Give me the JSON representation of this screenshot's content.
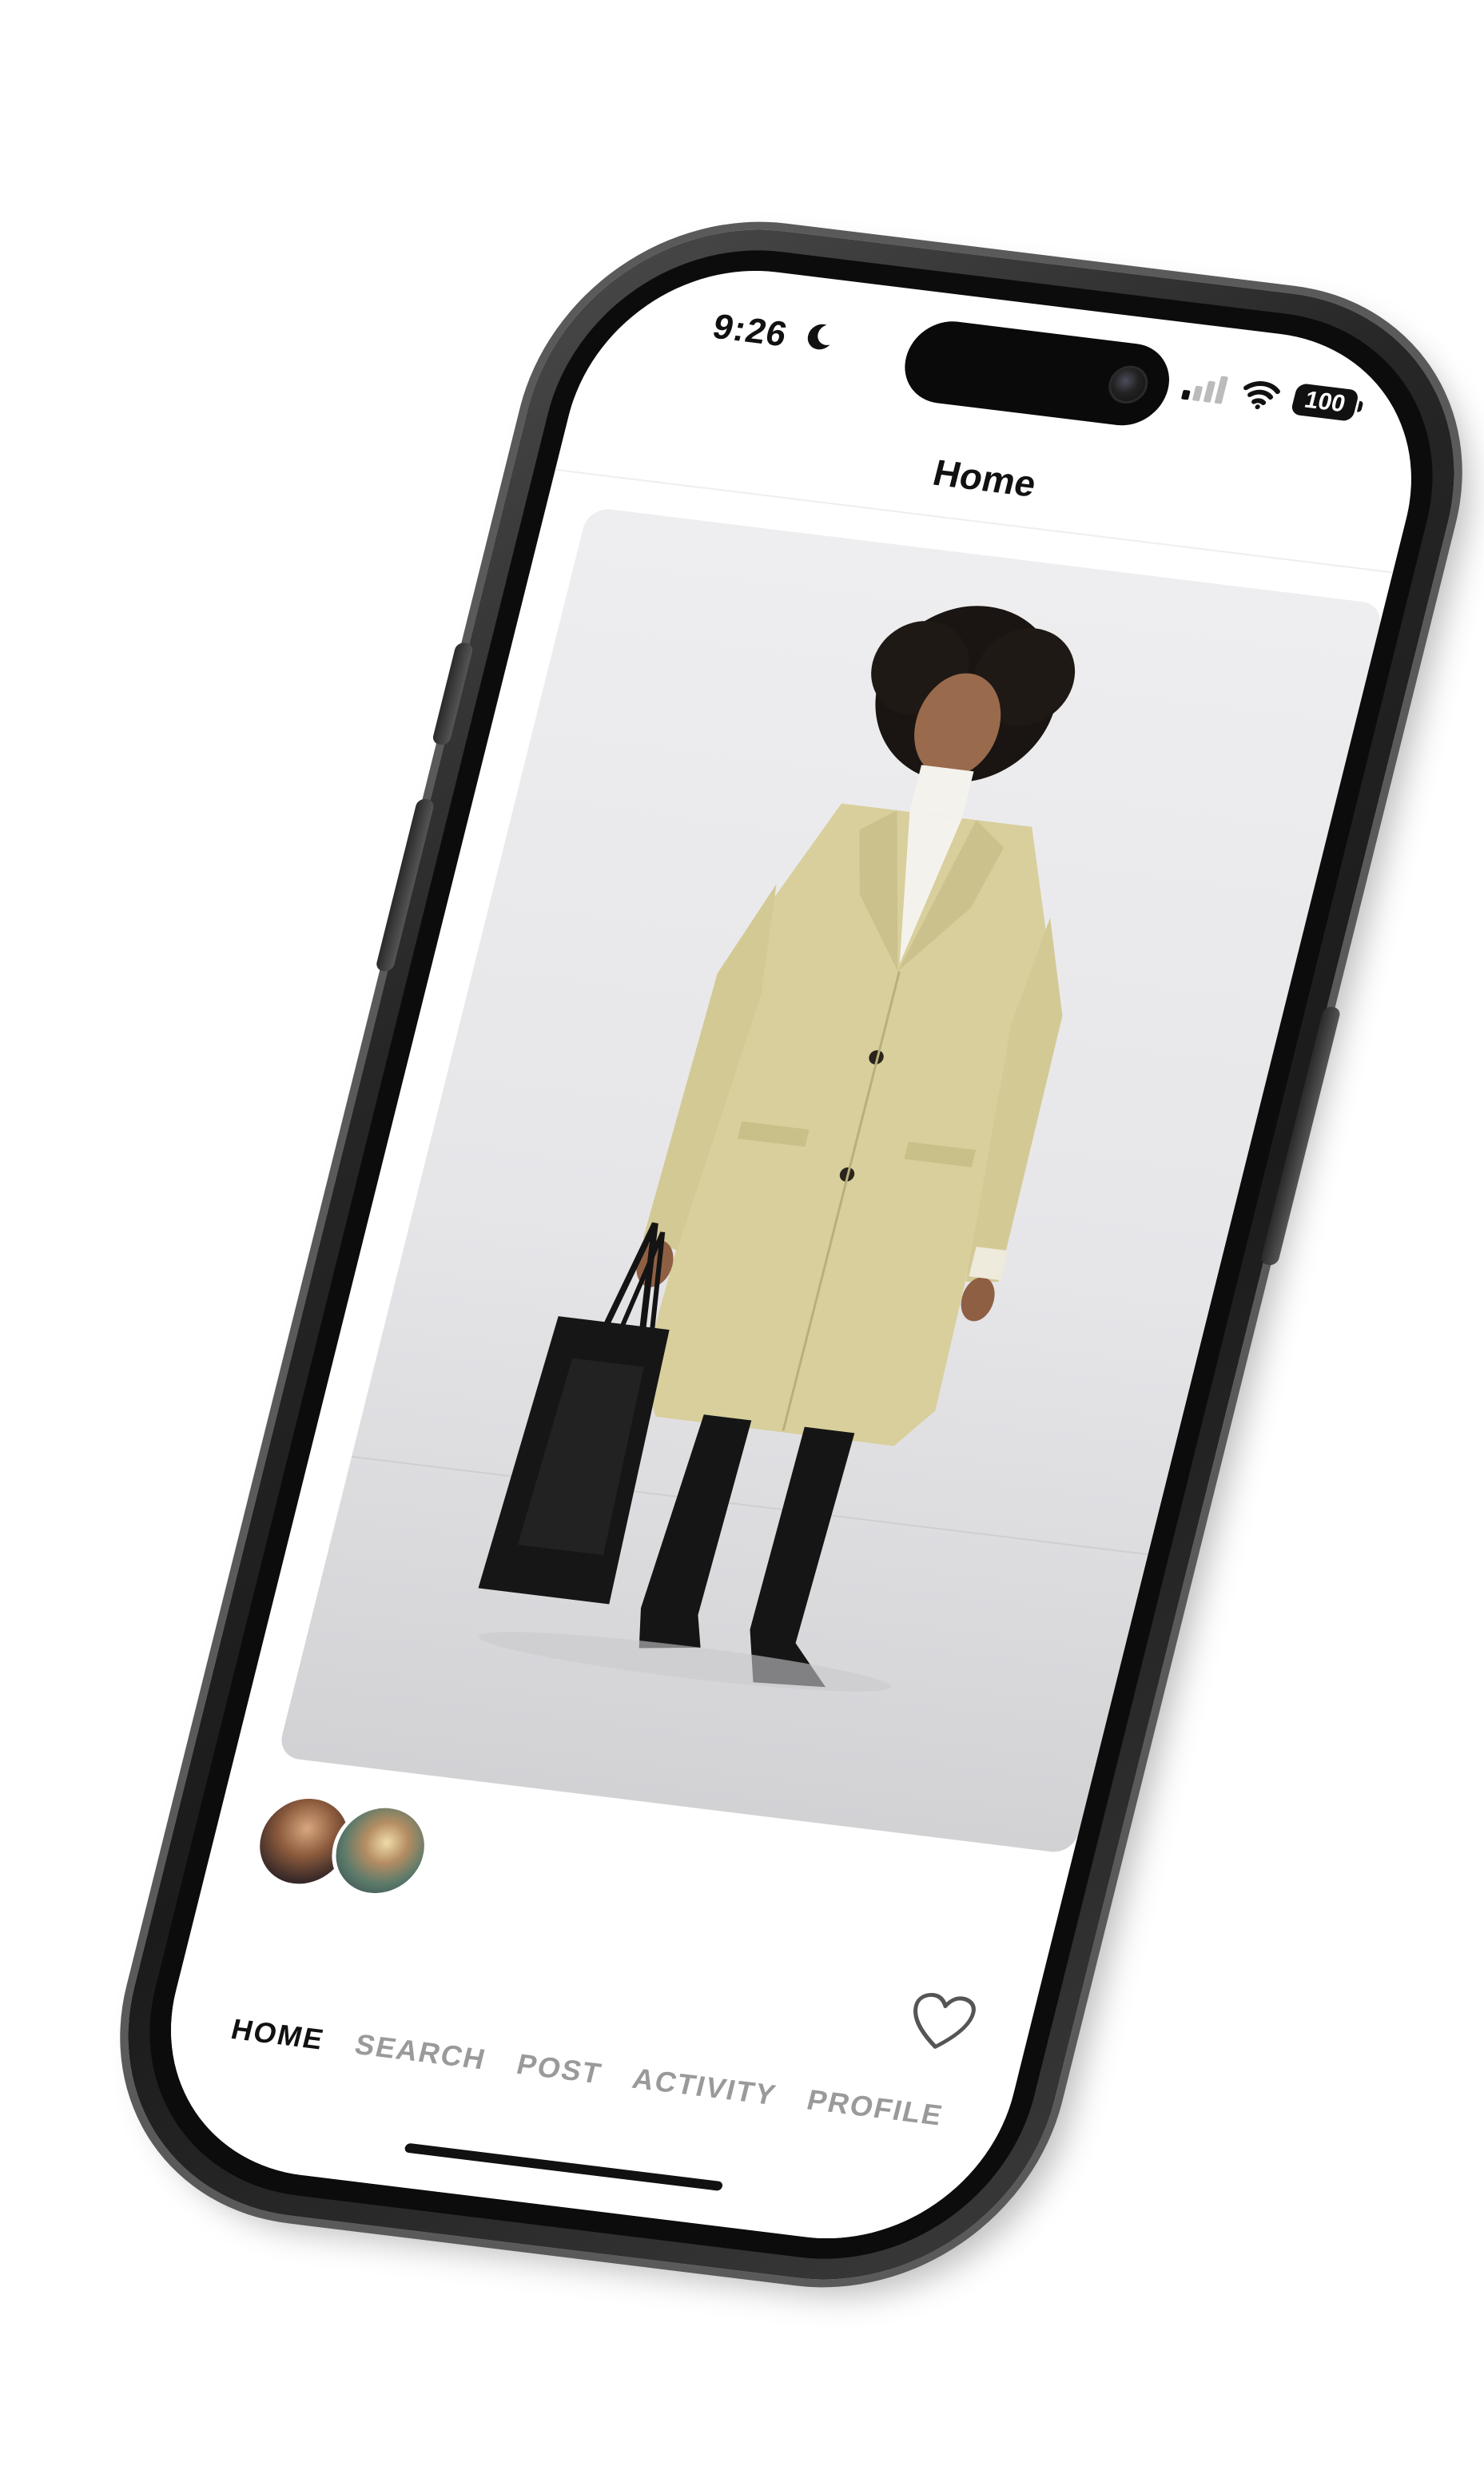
{
  "status_bar": {
    "time": "9:26",
    "battery": "100"
  },
  "header": {
    "title": "Home"
  },
  "tab_bar": {
    "items": [
      {
        "label": "HOME",
        "active": true
      },
      {
        "label": "SEARCH",
        "active": false
      },
      {
        "label": "POST",
        "active": false
      },
      {
        "label": "ACTIVITY",
        "active": false
      },
      {
        "label": "PROFILE",
        "active": false
      }
    ]
  },
  "colors": {
    "accent": "#111111",
    "inactive_tab": "#9a9a9a",
    "coat": "#d8cf9c"
  },
  "icons": [
    "moon-icon",
    "signal-icon",
    "wifi-icon",
    "battery-icon",
    "heart-icon"
  ]
}
